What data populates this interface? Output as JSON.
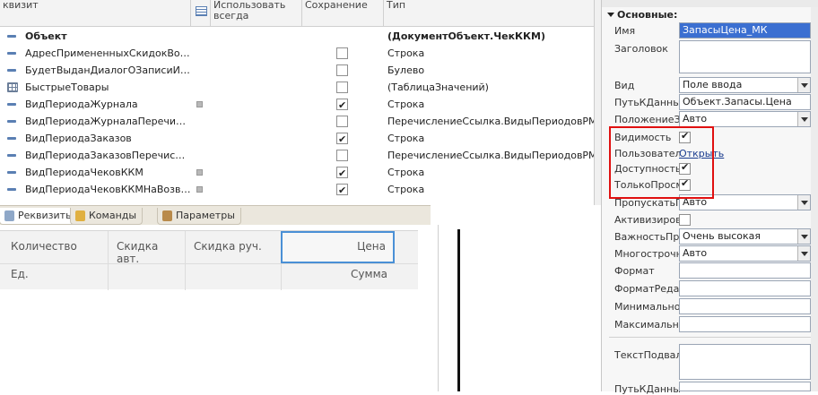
{
  "attributes": {
    "columns": {
      "name": "квизит",
      "use_always": "Использовать всегда",
      "save": "Сохранение",
      "type": "Тип"
    },
    "rows": [
      {
        "name": "Объект",
        "type": "(ДокументОбъект.ЧекККМ)",
        "bold": true,
        "icon": "line",
        "check": null,
        "dot": false
      },
      {
        "name": "АдресПримененныхСкидокВоВре...",
        "type": "Строка",
        "icon": "line",
        "check": false,
        "dot": false
      },
      {
        "name": "БудетВыданДиалогОЗаписиИзм...",
        "type": "Булево",
        "icon": "line",
        "check": false,
        "dot": false
      },
      {
        "name": "БыстрыеТовары",
        "type": "(ТаблицаЗначений)",
        "icon": "table",
        "check": false,
        "dot": false
      },
      {
        "name": "ВидПериодаЖурнала",
        "type": "Строка",
        "icon": "line",
        "check": true,
        "dot": true
      },
      {
        "name": "ВидПериодаЖурналаПеречислен...",
        "type": "ПеречислениеСсылка.ВидыПериодовРМК",
        "icon": "line",
        "check": false,
        "dot": false
      },
      {
        "name": "ВидПериодаЗаказов",
        "type": "Строка",
        "icon": "line",
        "check": true,
        "dot": false
      },
      {
        "name": "ВидПериодаЗаказовПеречисление",
        "type": "ПеречислениеСсылка.ВидыПериодовРМК",
        "icon": "line",
        "check": false,
        "dot": false
      },
      {
        "name": "ВидПериодаЧековККМ",
        "type": "Строка",
        "icon": "line",
        "check": true,
        "dot": true
      },
      {
        "name": "ВидПериодаЧековККМНаВозврат",
        "type": "Строка",
        "icon": "line",
        "check": true,
        "dot": true
      }
    ]
  },
  "tabs": [
    {
      "label": "Реквизиты",
      "icon": "attributes-icon",
      "active": true
    },
    {
      "label": "Команды",
      "icon": "commands-icon",
      "active": false
    },
    {
      "label": "Параметры",
      "icon": "parameters-icon",
      "active": false
    }
  ],
  "grid_preview": {
    "quantity": "Количество",
    "unit": "Ед.",
    "discount_auto": "Скидка авт.",
    "discount_manual": "Скидка руч.",
    "price": "Цена",
    "sum": "Сумма"
  },
  "properties": {
    "section": "Основные:",
    "name_label": "Имя",
    "name_value": "ЗапасыЦена_МК",
    "title_label": "Заголовок",
    "kind_label": "Вид",
    "kind_value": "Поле ввода",
    "data_path_label": "ПутьКДанным",
    "data_path_value": "Объект.Запасы.Цена",
    "title_position_label": "ПоложениеЗаголовка",
    "title_position_value": "Авто",
    "visibility_label": "Видимость",
    "user_visibility_label": "Пользовательская видимость",
    "user_visibility_link": "Открыть",
    "enabled_label": "Доступность",
    "readonly_label": "ТолькоПросмотр",
    "skip_input_label": "ПропускатьПриВводе",
    "skip_input_value": "Авто",
    "activate_label": "АктивизироватьПоУмолчанию",
    "importance_label": "ВажностьПриОтображении",
    "importance_value": "Очень высокая",
    "multiline_label": "МногострочныйРежим",
    "multiline_value": "Авто",
    "format_label": "Формат",
    "edit_format_label": "ФорматРедактирования",
    "min_label": "МинимальноеЗначение",
    "max_label": "МаксимальноеЗначение",
    "footer_text_label": "ТекстПодвала",
    "footer_path_label": "ПутьКДанным"
  },
  "colors": {
    "highlight_box": "#e01010",
    "selected_field": "#3b6fd1",
    "active_cell_border": "#4a90d6"
  }
}
